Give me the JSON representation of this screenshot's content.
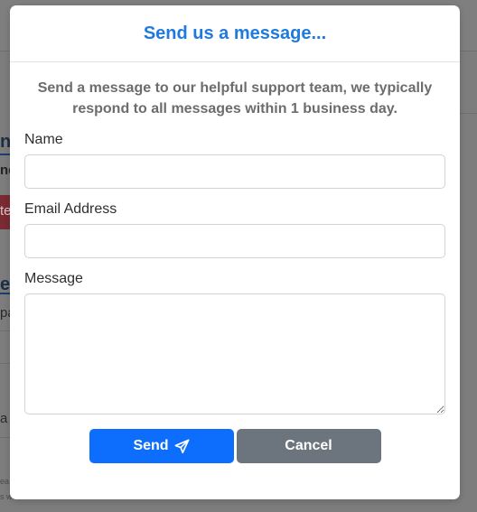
{
  "modal": {
    "title": "Send us a message...",
    "intro": "Send a message to our helpful support team, we typically respond to all messages within 1 business day.",
    "fields": {
      "name": {
        "label": "Name",
        "value": "",
        "placeholder": ""
      },
      "email": {
        "label": "Email Address",
        "value": "",
        "placeholder": ""
      },
      "message": {
        "label": "Message",
        "value": "",
        "placeholder": ""
      }
    },
    "buttons": {
      "send": {
        "label": "Send",
        "icon": "paper-plane-icon"
      },
      "cancel": {
        "label": "Cancel"
      }
    }
  },
  "colors": {
    "title": "#1f7ae0",
    "send_button": "#0d6efd",
    "cancel_button": "#6c757d",
    "overlay": "#7d7d7d"
  }
}
